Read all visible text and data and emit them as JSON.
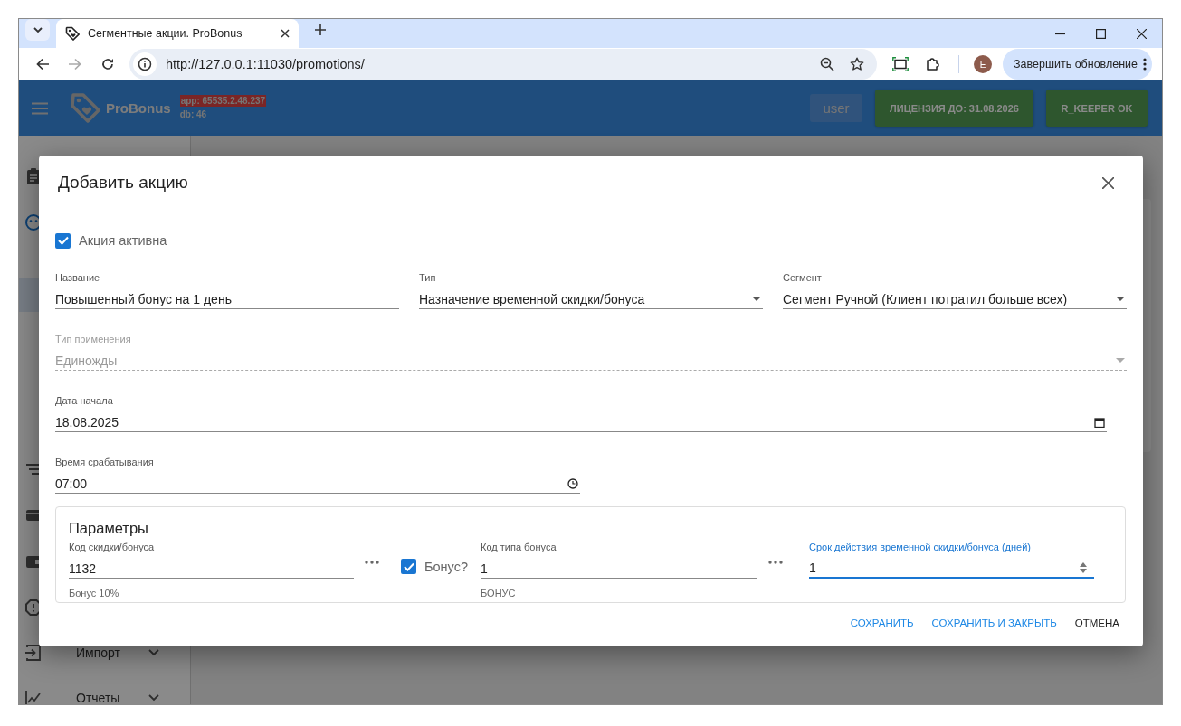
{
  "browser": {
    "tab": {
      "title": "Сегментные акции. ProBonus",
      "selected": true
    },
    "address": "http://127.0.0.1:11030/promotions/",
    "profile_initial": "E",
    "update_button": "Завершить обновление"
  },
  "app_header": {
    "brand": "ProBonus",
    "app_version": "app: 65535.2.46.237",
    "db_version": "db: 46",
    "user_button": "user",
    "license_button": "ЛИЦЕНЗИЯ ДО: 31.08.2026",
    "rkeeper_button": "R_KEEPER OK"
  },
  "sidebar": {
    "items": [
      {
        "kind": "icon"
      },
      {
        "kind": "icon"
      },
      {
        "kind": "sub",
        "selected": false
      },
      {
        "kind": "sub",
        "selected": true
      },
      {
        "kind": "sub",
        "selected": false
      },
      {
        "kind": "sub",
        "selected": false
      },
      {
        "kind": "sub",
        "selected": false
      },
      {
        "kind": "sub",
        "selected": false
      },
      {
        "kind": "icon"
      },
      {
        "kind": "icon"
      },
      {
        "kind": "icon"
      },
      {
        "kind": "icon"
      },
      {
        "kind": "group",
        "label": "Импорт"
      },
      {
        "kind": "group",
        "label": "Отчеты"
      }
    ]
  },
  "dialog": {
    "title": "Добавить акцию",
    "active": {
      "label": "Акция активна",
      "checked": true
    },
    "rows": [
      [
        {
          "kind": "text",
          "label": "Название",
          "value": "Повышенный бонус на 1 день",
          "disabled": false
        },
        {
          "kind": "select",
          "label": "Тип",
          "value": "Назначение временной скидки/бонуса",
          "disabled": false
        },
        {
          "kind": "select",
          "label": "Сегмент",
          "value": "Сегмент Ручной (Клиент потратил больше всех)",
          "disabled": false
        }
      ],
      [
        {
          "kind": "select",
          "label": "Тип применения",
          "value": "Единожды",
          "disabled": true
        }
      ],
      [
        {
          "kind": "date",
          "label": "Дата начала",
          "value": "18.08.2025",
          "disabled": false
        }
      ],
      [
        {
          "kind": "time",
          "label": "Время срабатывания",
          "value": "07:00",
          "disabled": false
        }
      ]
    ],
    "parameters": {
      "title": "Параметры",
      "items": [
        {
          "kind": "lookup",
          "label": "Код скидки/бонуса",
          "value": "1132",
          "helper": "Бонус 10%",
          "focused": false
        },
        {
          "kind": "checkbox",
          "label": "Бонус?",
          "checked": true
        },
        {
          "kind": "lookup",
          "label": "Код типа бонуса",
          "value": "1",
          "helper": "БОНУС",
          "focused": false
        },
        {
          "kind": "number",
          "label": "Срок действия временной скидки/бонуса (дней)",
          "value": "1",
          "focused": true
        }
      ]
    },
    "buttons": [
      {
        "label": "СОХРАНИТЬ",
        "kind": "primary"
      },
      {
        "label": "СОХРАНИТЬ И ЗАКРЫТЬ",
        "kind": "primary"
      },
      {
        "label": "ОТМЕНА",
        "kind": "default"
      }
    ]
  }
}
